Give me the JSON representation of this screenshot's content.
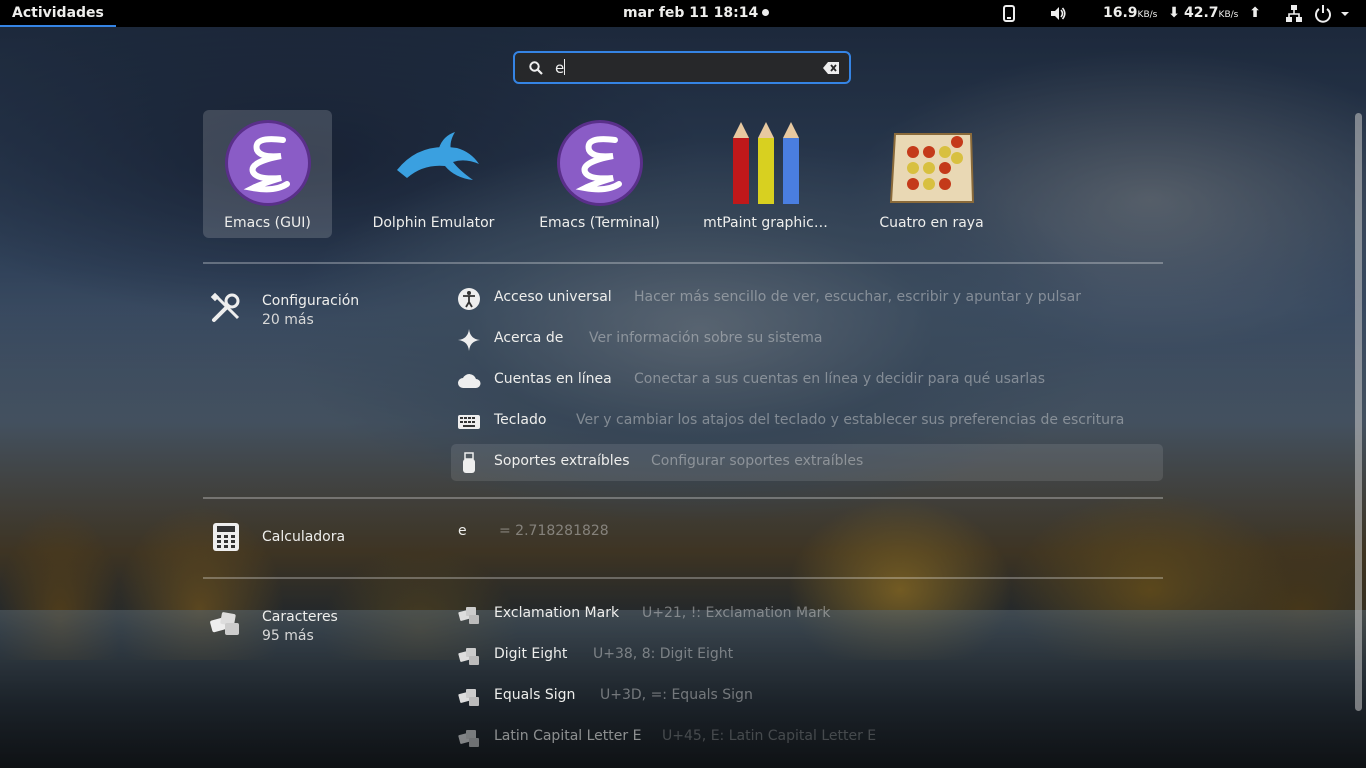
{
  "topbar": {
    "activities": "Actividades",
    "clock": "mar feb 11  18:14",
    "net_down_value": "16.9",
    "net_down_unit": "KB/s",
    "net_up_value": "42.7",
    "net_up_unit": "KB/s"
  },
  "search": {
    "query": "e"
  },
  "apps": [
    {
      "label": "Emacs (GUI)",
      "icon": "emacs-icon"
    },
    {
      "label": "Dolphin Emulator",
      "icon": "dolphin-icon"
    },
    {
      "label": "Emacs (Terminal)",
      "icon": "emacs-icon"
    },
    {
      "label": "mtPaint graphic…",
      "icon": "pencils-icon"
    },
    {
      "label": "Cuatro en raya",
      "icon": "connect-four-icon"
    }
  ],
  "settings": {
    "title": "Configuración",
    "more": "20 más",
    "results": [
      {
        "title": "Acceso universal",
        "desc": "Hacer más sencillo de ver, escuchar, escribir y apuntar y pulsar"
      },
      {
        "title": "Acerca de",
        "desc": "Ver información sobre su sistema"
      },
      {
        "title": "Cuentas en línea",
        "desc": "Conectar a sus cuentas en línea y decidir para qué usarlas"
      },
      {
        "title": "Teclado",
        "desc": "Ver y cambiar los atajos del teclado y establecer sus preferencias de escritura"
      },
      {
        "title": "Soportes extraíbles",
        "desc": "Configurar soportes extraíbles"
      }
    ]
  },
  "calculator": {
    "title": "Calculadora",
    "expression": "e",
    "result": "= 2.718281828"
  },
  "characters": {
    "title": "Caracteres",
    "more": "95 más",
    "results": [
      {
        "title": "Exclamation Mark",
        "desc": "U+21, !: Exclamation Mark"
      },
      {
        "title": "Digit Eight",
        "desc": "U+38, 8: Digit Eight"
      },
      {
        "title": "Equals Sign",
        "desc": "U+3D, =: Equals Sign"
      },
      {
        "title": "Latin Capital Letter E",
        "desc": "U+45, E: Latin Capital Letter E"
      }
    ]
  },
  "colors": {
    "accent": "#3584e4",
    "topbar": "#000000"
  }
}
